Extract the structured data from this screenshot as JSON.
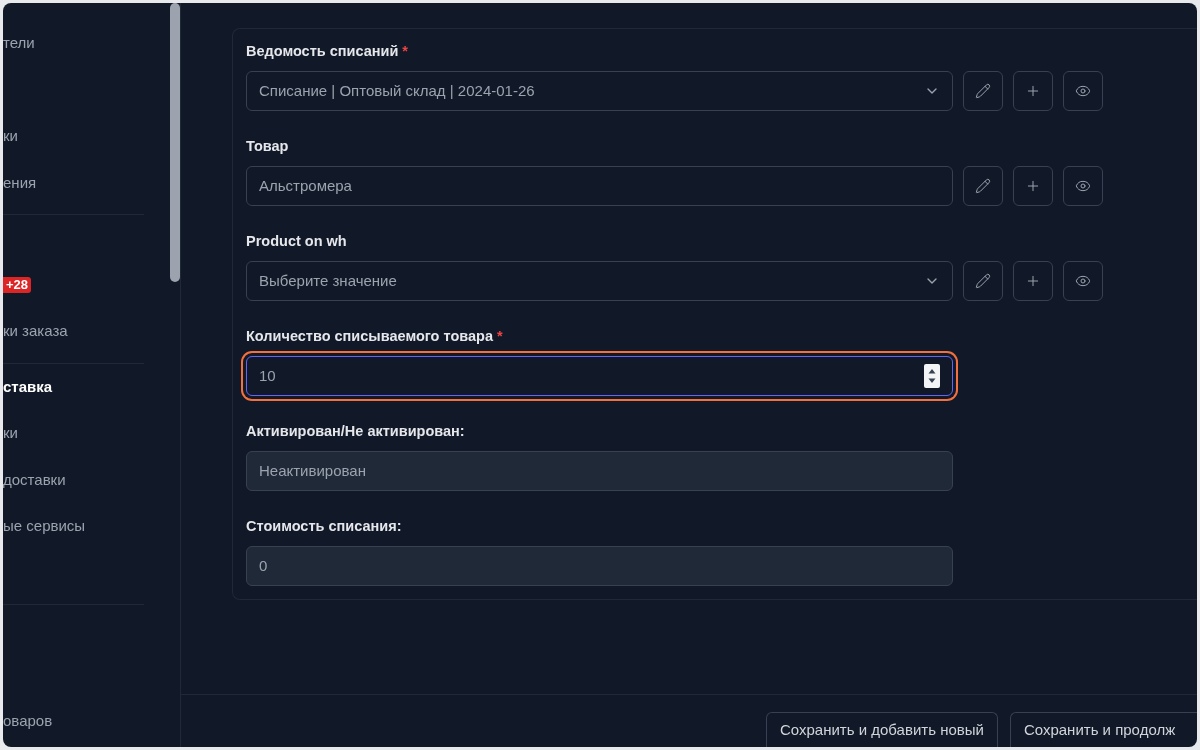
{
  "sidebar": {
    "sections": [
      {
        "items": [
          {
            "kind": "link",
            "label": "тели",
            "selected": false
          },
          {
            "kind": "link",
            "label": "ки",
            "selected": false
          },
          {
            "kind": "link",
            "label": "ения",
            "selected": false
          }
        ]
      },
      {
        "items": [
          {
            "kind": "badge",
            "badge": "+28",
            "selected": false
          },
          {
            "kind": "link",
            "label": "ки заказа",
            "selected": false
          }
        ]
      },
      {
        "items": [
          {
            "kind": "link",
            "label": "ставка",
            "selected": true
          },
          {
            "kind": "link",
            "label": "ки",
            "selected": false
          },
          {
            "kind": "link",
            "label": "доставки",
            "selected": false
          },
          {
            "kind": "link",
            "label": "ые сервисы",
            "selected": false
          }
        ]
      },
      {
        "items": [
          {
            "kind": "link",
            "label": "оваров",
            "selected": false
          }
        ]
      }
    ]
  },
  "form": {
    "fields": [
      {
        "label": "Ведомость списаний",
        "required_mark": "*",
        "kind": "select",
        "value": "Списание | Оптовый склад | 2024-01-26",
        "focused": false,
        "readonly": false,
        "actions": [
          {
            "kind": "edit"
          },
          {
            "kind": "add"
          },
          {
            "kind": "view"
          }
        ]
      },
      {
        "label": "Товар",
        "kind": "text",
        "value": "Альстромера",
        "focused": false,
        "readonly": false,
        "actions": [
          {
            "kind": "edit"
          },
          {
            "kind": "add"
          },
          {
            "kind": "view"
          }
        ]
      },
      {
        "label": "Product on wh",
        "kind": "select",
        "placeholder": "Выберите значение",
        "focused": false,
        "readonly": false,
        "actions": [
          {
            "kind": "edit"
          },
          {
            "kind": "add"
          },
          {
            "kind": "view"
          }
        ]
      },
      {
        "label": "Количество списываемого товара",
        "required_mark": "*",
        "kind": "number",
        "value": "10",
        "focused": true,
        "readonly": false
      },
      {
        "label": "Активирован/Не активирован:",
        "kind": "text",
        "value": "Неактивирован",
        "focused": false,
        "readonly": true
      },
      {
        "label": "Стоимость списания:",
        "kind": "text",
        "value": "0",
        "focused": false,
        "readonly": true
      }
    ]
  },
  "footer": {
    "buttons": [
      {
        "label": "Сохранить и добавить новый"
      },
      {
        "label": "Сохранить и продолж"
      }
    ]
  }
}
